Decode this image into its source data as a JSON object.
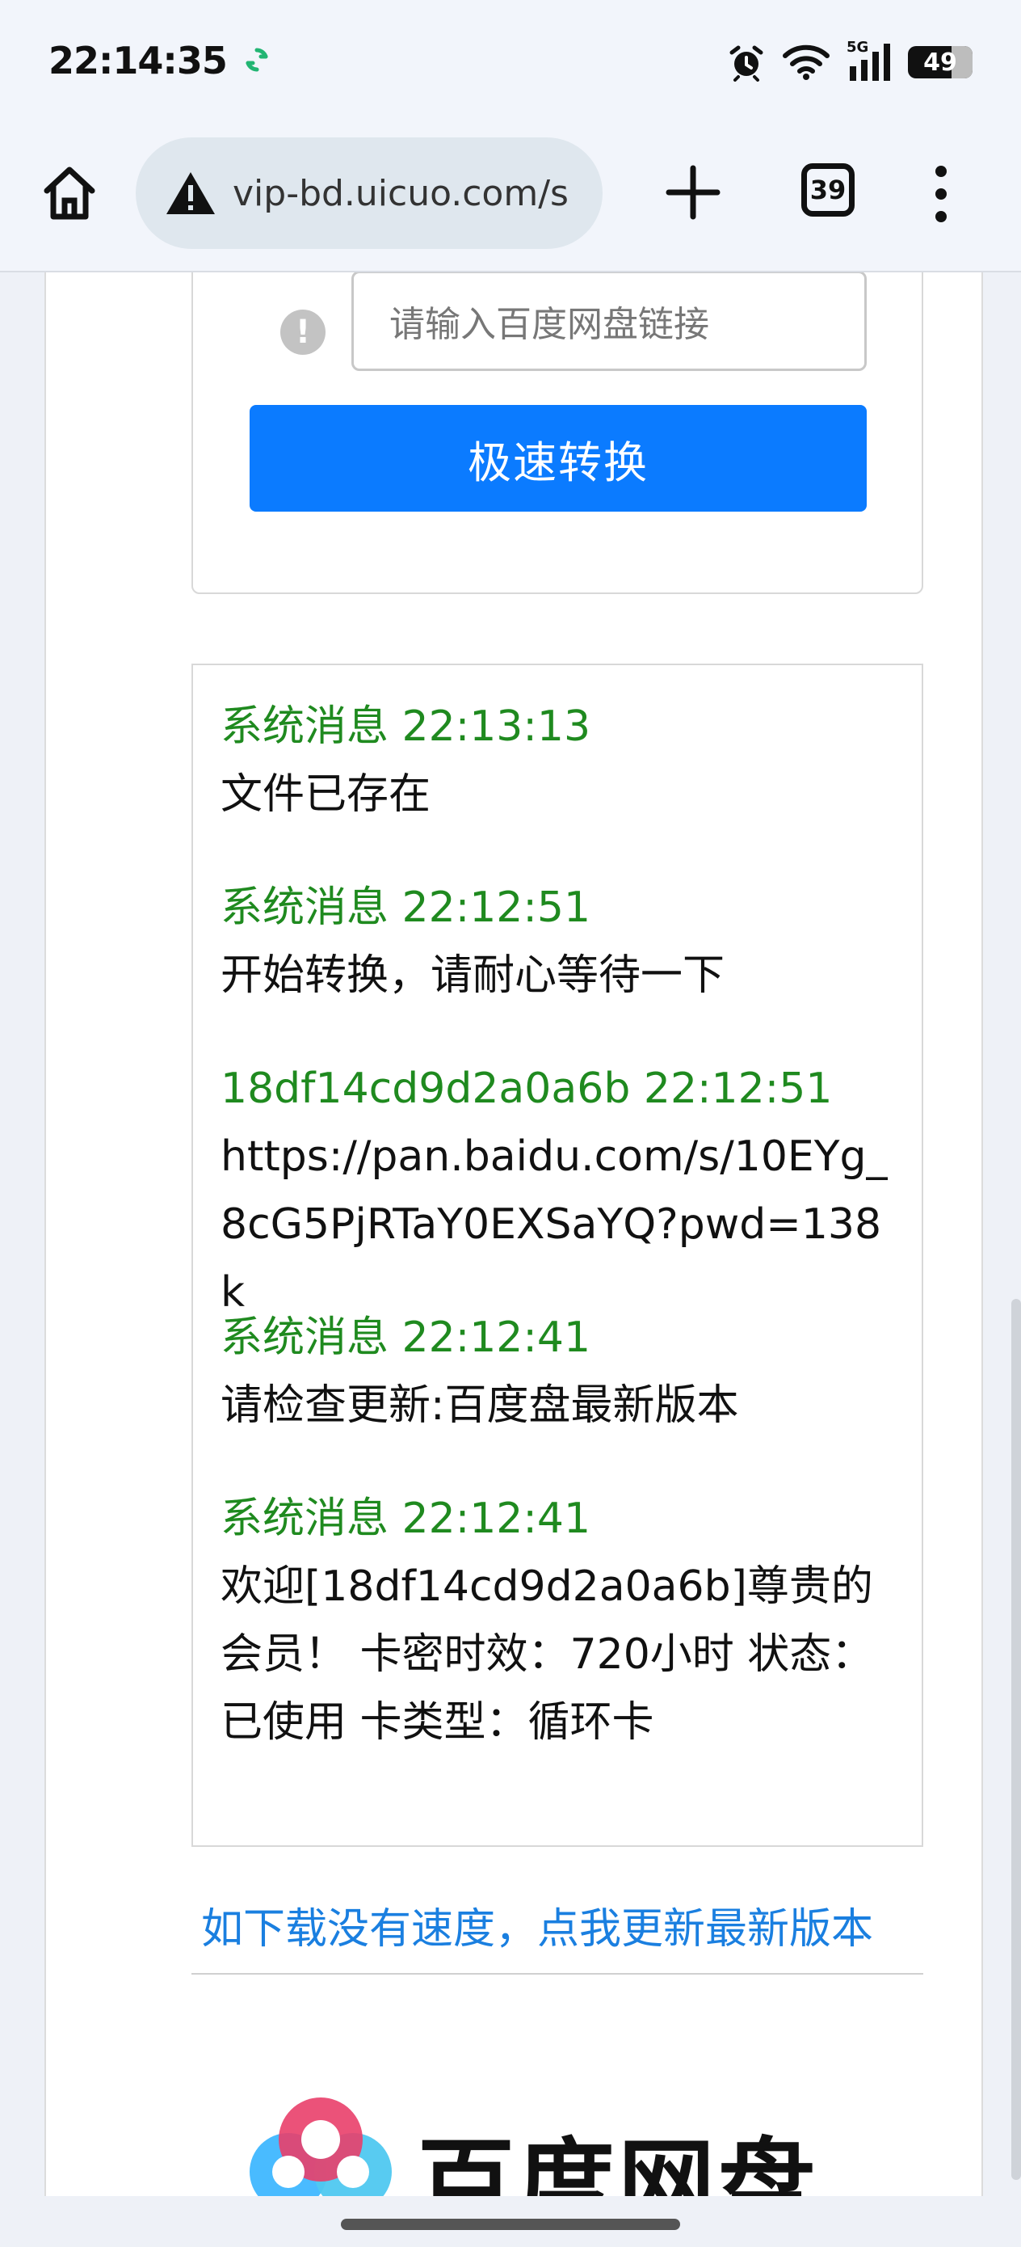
{
  "status_bar": {
    "time": "22:14:35",
    "network": "5G",
    "battery": "49",
    "icons": [
      "sync-icon",
      "alarm-icon",
      "wifi-icon",
      "signal-icon",
      "battery-icon"
    ]
  },
  "browser": {
    "url": "vip-bd.uicuo.com/s",
    "tab_count": "39",
    "icons": [
      "home-icon",
      "warning-icon",
      "plus-icon",
      "tabs-icon",
      "more-vert-icon"
    ]
  },
  "form": {
    "input_placeholder": "请输入百度网盘链接",
    "convert_button": "极速转换"
  },
  "log": [
    {
      "head": "系统消息 22:13:13",
      "body": "文件已存在"
    },
    {
      "head": "系统消息 22:12:51",
      "body": "开始转换，请耐心等待一下"
    },
    {
      "head": "18df14cd9d2a0a6b 22:12:51",
      "body": "https://pan.baidu.com/s/10EYg_8cG5PjRTaY0EXSaYQ?pwd=138k"
    },
    {
      "head": "系统消息 22:12:41",
      "body": "请检查更新:百度盘最新版本"
    },
    {
      "head": "系统消息 22:12:41",
      "body": "欢迎[18df14cd9d2a0a6b]尊贵的会员！ 卡密时效：720小时 状态：已使用 卡类型：循环卡"
    }
  ],
  "update_link": "如下载没有速度，点我更新最新版本",
  "logo_text": "百度网盘",
  "colors": {
    "accent_blue": "#0b7bff",
    "log_green": "#1f8a1f",
    "link_blue": "#1a7fe0"
  }
}
